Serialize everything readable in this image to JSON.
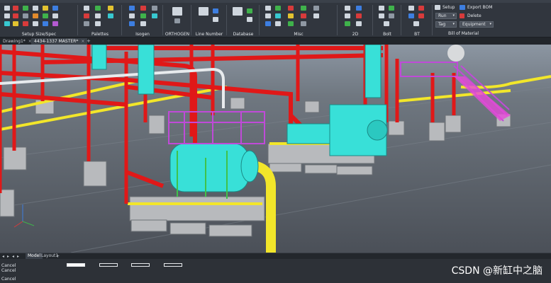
{
  "ribbon": {
    "groups": [
      {
        "label": "Setup Size/Spec"
      },
      {
        "label": "Palettes"
      },
      {
        "label": "Isogen"
      },
      {
        "label": "ORTHOGEN"
      },
      {
        "label": "Line Number"
      },
      {
        "label": "Database"
      },
      {
        "label": "Misc"
      },
      {
        "label": "2D"
      },
      {
        "label": "Bolt"
      },
      {
        "label": "BT"
      }
    ],
    "bom": {
      "setup_label": "Setup",
      "export_label": "Export BOM",
      "delete_label": "Delete",
      "run_value": "Run",
      "tag_value": "Tag",
      "equipment_value": "Equipment",
      "group_label": "Bill of Material"
    }
  },
  "tabs": {
    "items": [
      {
        "label": "Drawing1*",
        "close": "×"
      },
      {
        "label": "4434-1337 MASTER*",
        "close": "×"
      }
    ],
    "add": "+"
  },
  "layout_bar": {
    "nav": [
      "◂",
      "▸",
      "◂",
      "▸"
    ],
    "model": "Model",
    "layout1": "Layout1",
    "add": "+"
  },
  "command": {
    "lines": [
      "Cancel",
      "Cancel",
      "Cancel"
    ]
  },
  "watermark": "CSDN @新缸中之脑"
}
